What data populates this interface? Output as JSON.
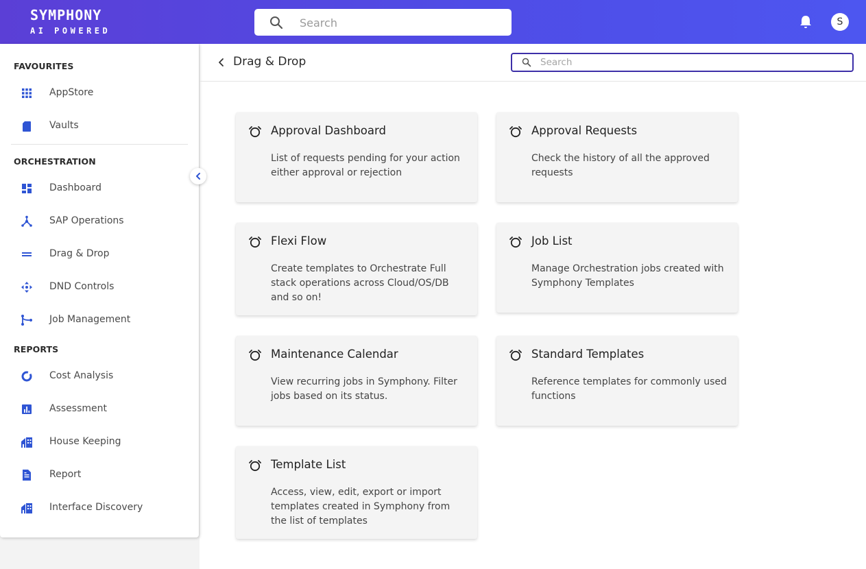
{
  "header": {
    "brand_name": "SYMPHONY",
    "brand_tagline": "AI POWERED",
    "search_placeholder": "Search",
    "user_initial": "S"
  },
  "sidebar": {
    "sections": [
      {
        "title": "FAVOURITES",
        "items": [
          {
            "label": "AppStore",
            "icon": "apps-grid-icon"
          },
          {
            "label": "Vaults",
            "icon": "sd-card-icon"
          }
        ]
      },
      {
        "title": "ORCHESTRATION",
        "items": [
          {
            "label": "Dashboard",
            "icon": "dashboard-icon"
          },
          {
            "label": "SAP Operations",
            "icon": "hub-icon"
          },
          {
            "label": "Drag & Drop",
            "icon": "drag-handle-icon"
          },
          {
            "label": "DND Controls",
            "icon": "move-arrows-icon"
          },
          {
            "label": "Job Management",
            "icon": "branch-icon"
          }
        ]
      },
      {
        "title": "REPORTS",
        "items": [
          {
            "label": "Cost Analysis",
            "icon": "donut-chart-icon"
          },
          {
            "label": "Assessment",
            "icon": "bar-chart-icon"
          },
          {
            "label": "House Keeping",
            "icon": "buildings-icon"
          },
          {
            "label": "Report",
            "icon": "document-icon"
          },
          {
            "label": "Interface Discovery",
            "icon": "buildings-icon"
          }
        ]
      }
    ]
  },
  "main": {
    "title": "Drag & Drop",
    "search_placeholder": "Search",
    "cards": [
      {
        "title": "Approval Dashboard",
        "description": "List of requests pending for your action either approval or rejection"
      },
      {
        "title": "Approval Requests",
        "description": "Check the history of all the approved requests"
      },
      {
        "title": "Flexi Flow",
        "description": "Create templates to Orchestrate Full stack operations across Cloud/OS/DB and so on!"
      },
      {
        "title": "Job List",
        "description": "Manage Orchestration jobs created with Symphony Templates"
      },
      {
        "title": "Maintenance Calendar",
        "description": "View recurring jobs in Symphony. Filter jobs based on its status."
      },
      {
        "title": "Standard Templates",
        "description": "Reference templates for commonly used functions"
      },
      {
        "title": "Template List",
        "description": "Access, view, edit, export or import templates created in Symphony from the list of templates"
      }
    ]
  },
  "colors": {
    "header_gradient_start": "#5b3fd6",
    "header_gradient_end": "#4d56f0",
    "accent_blue": "#2f55d4",
    "search_border": "#3d2fa8",
    "card_bg": "#f4f4f4"
  }
}
